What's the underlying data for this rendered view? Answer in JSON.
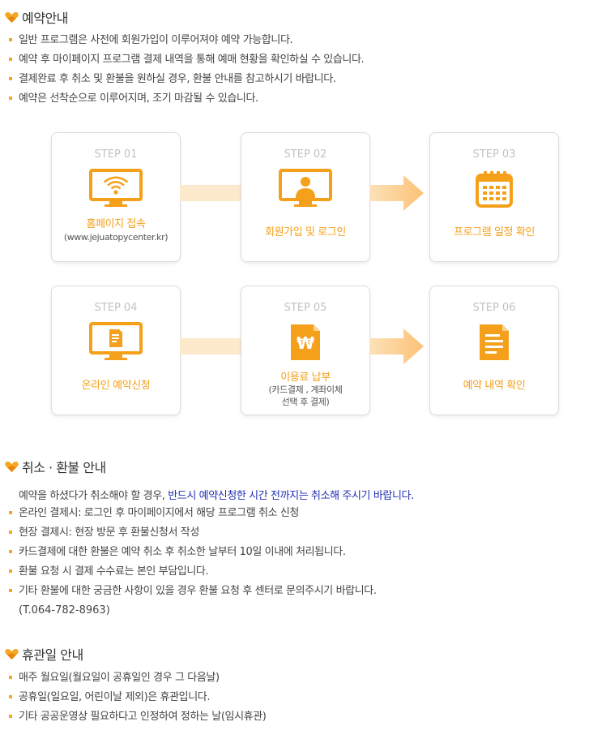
{
  "colors": {
    "accent": "#f5a01a",
    "bullet": "#f5a623",
    "highlight": "#1f2fb5",
    "step_no": "#c2c2c2"
  },
  "reservation": {
    "title": "예약안내",
    "items": [
      "일반 프로그램은 사전에 회원가입이 이루어져야 예약 가능합니다.",
      "예약 후 마이페이지 프로그램 결제 내역을 통해 예매 현황을 확인하실 수 있습니다.",
      "결제완료 후 취소 및 환불을 원하실 경우, 환불 안내를 참고하시기 바랍니다.",
      "예약은 선착순으로 이루어지며, 조기 마감될 수 있습니다."
    ]
  },
  "steps": [
    {
      "no": "STEP 01",
      "label": "홈페이지 접속",
      "sub": "(www.jejuatopycenter.kr)",
      "icon": "monitor-wifi-icon"
    },
    {
      "no": "STEP 02",
      "label": "회원가입 및 로그인",
      "sub": "",
      "icon": "monitor-user-icon"
    },
    {
      "no": "STEP 03",
      "label": "프로그램 일정 확인",
      "sub": "",
      "icon": "calendar-icon"
    },
    {
      "no": "STEP 04",
      "label": "온라인 예약신청",
      "sub": "",
      "icon": "monitor-document-icon"
    },
    {
      "no": "STEP 05",
      "label": "이용료 납부",
      "sub1": "(카드결제 , 계좌이체",
      "sub2": "선택 후 결제)",
      "icon": "won-document-icon"
    },
    {
      "no": "STEP 06",
      "label": "예약 내역 확인",
      "sub": "",
      "icon": "document-icon"
    }
  ],
  "refund": {
    "title": "취소 · 환불 안내",
    "lead_plain": "예약을 하셨다가 취소해야 할 경우, ",
    "lead_emphasis": "반드시 예약신청한 시간 전까지는 취소해 주시기 바랍니다.",
    "items": [
      "온라인 결제시: 로그인 후 마이페이지에서 해당 프로그램 취소 신청",
      "현장 결제시: 현장 방문 후 환불신청서 작성",
      "카드결제에 대한 환불은 예약 취소 후 취소한 날부터 10일 이내에 처리됩니다.",
      "환불 요청 시 결제 수수료는 본인 부담입니다.",
      "기타 환불에 대한 궁금한 사항이 있을 경우 환불 요청 후 센터로 문의주시기 바랍니다."
    ],
    "phone": "(T.064-782-8963)"
  },
  "closed": {
    "title": "휴관일 안내",
    "items": [
      "매주 월요일(월요일이 공휴일인 경우 그 다음날)",
      "공휴일(일요일, 어린이날 제외)은 휴관입니다.",
      "기타 공공운영상 필요하다고 인정하여 정하는 날(임시휴관)"
    ]
  }
}
